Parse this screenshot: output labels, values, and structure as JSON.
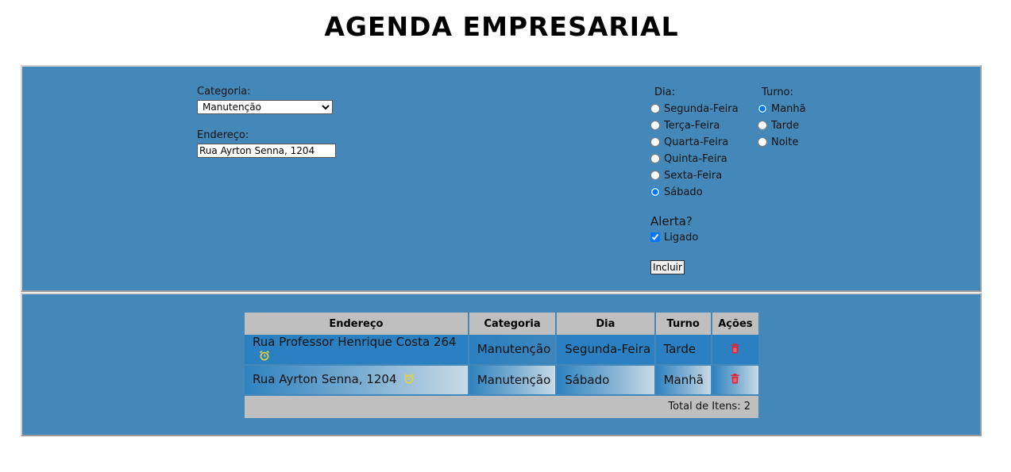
{
  "title": "AGENDA EMPRESARIAL",
  "form": {
    "categoria_label": "Categoria:",
    "categoria_value": "Manutenção",
    "endereco_label": "Endereço:",
    "endereco_value": "Rua Ayrton Senna, 1204",
    "dia_label": "Dia:",
    "dias": [
      "Segunda-Feira",
      "Terça-Feira",
      "Quarta-Feira",
      "Quinta-Feira",
      "Sexta-Feira",
      "Sábado"
    ],
    "dia_selected": "Sábado",
    "turno_label": "Turno:",
    "turnos": [
      "Manhã",
      "Tarde",
      "Noite"
    ],
    "turno_selected": "Manhã",
    "alerta_label": "Alerta?",
    "ligado_label": "Ligado",
    "ligado_checked": true,
    "incluir_label": "Incluir"
  },
  "table": {
    "headers": [
      "Endereço",
      "Categoria",
      "Dia",
      "Turno",
      "Ações"
    ],
    "rows": [
      {
        "endereco": "Rua Professor Henrique Costa 264",
        "categoria": "Manutenção",
        "dia": "Segunda-Feira",
        "turno": "Tarde",
        "alarm_icon": "alarm-clock-icon",
        "action_icon": "trash-icon"
      },
      {
        "endereco": "Rua Ayrton Senna, 1204",
        "categoria": "Manutenção",
        "dia": "Sábado",
        "turno": "Manhã",
        "alarm_icon": "alarm-clock-icon",
        "action_icon": "trash-icon"
      }
    ],
    "total": "Total de Itens: 2"
  },
  "colors": {
    "panel": "#4388b8",
    "header_bg": "#c0bfc0",
    "alarm": "#e8d23a",
    "trash": "#e0223a"
  }
}
